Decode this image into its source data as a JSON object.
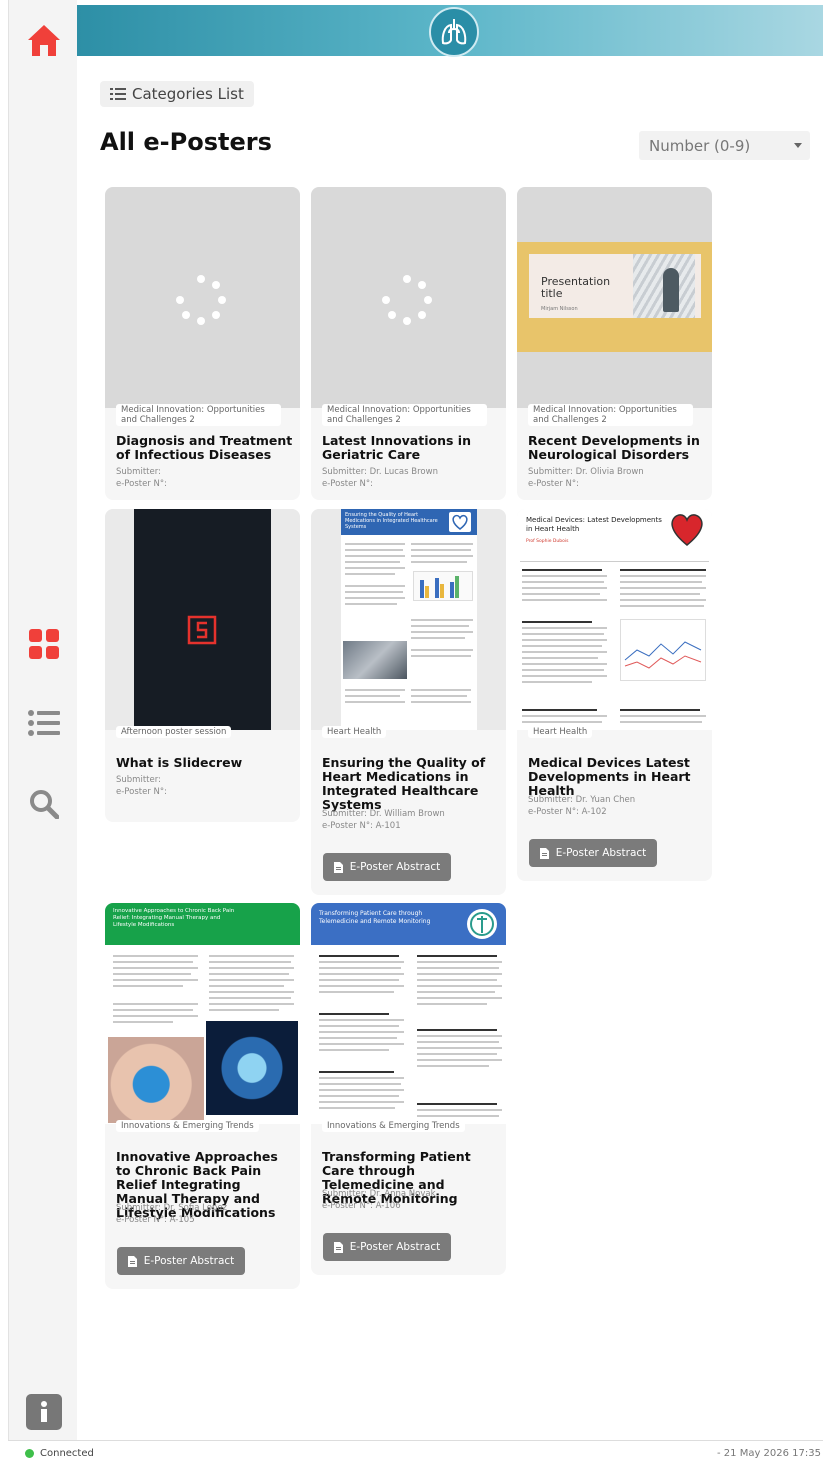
{
  "header": {
    "categories_label": "Categories List",
    "page_title": "All e-Posters",
    "sort_value": "Number (0-9)"
  },
  "icons": {
    "home": "home-icon",
    "grid": "grid-icon",
    "list": "list-icon",
    "search": "search-icon",
    "info": "info-icon",
    "logo": "lungs-icon"
  },
  "colors": {
    "accent_red": "#f0403a",
    "banner_teal": "#2d8fa6",
    "button_grey": "#7b7b7b",
    "connected_green": "#3fbf4a"
  },
  "cards": [
    {
      "tag": "Medical Innovation: Opportunities and Challenges 2",
      "title": "Diagnosis and Treatment of Infectious Diseases",
      "submitter": "Submitter:",
      "number": "e-Poster N°:"
    },
    {
      "tag": "Medical Innovation: Opportunities and Challenges 2",
      "title": "Latest Innovations in Geriatric Care",
      "submitter": "Submitter: Dr. Lucas Brown",
      "number": "e-Poster N°:"
    },
    {
      "tag": "Medical Innovation: Opportunities and Challenges 2",
      "title": "Recent Developments in Neurological Disorders",
      "submitter": "Submitter: Dr. Olivia Brown",
      "number": "e-Poster N°:",
      "thumb_text": "Presentation title",
      "thumb_sub": "Mirjam Nilsson"
    },
    {
      "tag": "Afternoon poster session",
      "title": "What is Slidecrew",
      "submitter": "Submitter:",
      "number": "e-Poster N°:"
    },
    {
      "tag": "Heart Health",
      "title": "Ensuring the Quality of Heart Medications in Integrated Healthcare Systems",
      "submitter": "Submitter: Dr. William Brown",
      "number": "e-Poster N°: A-101",
      "button": "E-Poster Abstract",
      "thumb_text": "Ensuring the Quality of Heart Medications in Integrated Healthcare Systems"
    },
    {
      "tag": "Heart Health",
      "title": "Medical Devices Latest Developments in Heart Health",
      "submitter": "Submitter: Dr. Yuan Chen",
      "number": "e-Poster N°: A-102",
      "button": "E-Poster Abstract",
      "thumb_text": "Medical Devices: Latest Developments in Heart Health",
      "thumb_sub": "Prof Sophie Dubois"
    },
    {
      "tag": "Innovations & Emerging Trends",
      "title": "Innovative Approaches to Chronic Back Pain Relief Integrating Manual Therapy and Lifestyle Modifications",
      "submitter": "Submitter: Dr. Sofia Lopez",
      "number": "e-Poster N°: A-105",
      "button": "E-Poster Abstract",
      "thumb_text": "Innovative Approaches to Chronic Back Pain Relief: Integrating Manual Therapy and Lifestyle Modifications"
    },
    {
      "tag": "Innovations & Emerging Trends",
      "title": "Transforming Patient Care through Telemedicine and Remote Monitoring",
      "submitter": "Submitter: Dr. Anna Novak",
      "number": "e-Poster N°: A-106",
      "button": "E-Poster Abstract",
      "thumb_text": "Transforming Patient Care through Telemedicine and Remote Monitoring"
    }
  ],
  "status": {
    "connection": "Connected",
    "datetime": "- 21 May 2026  17:35"
  }
}
